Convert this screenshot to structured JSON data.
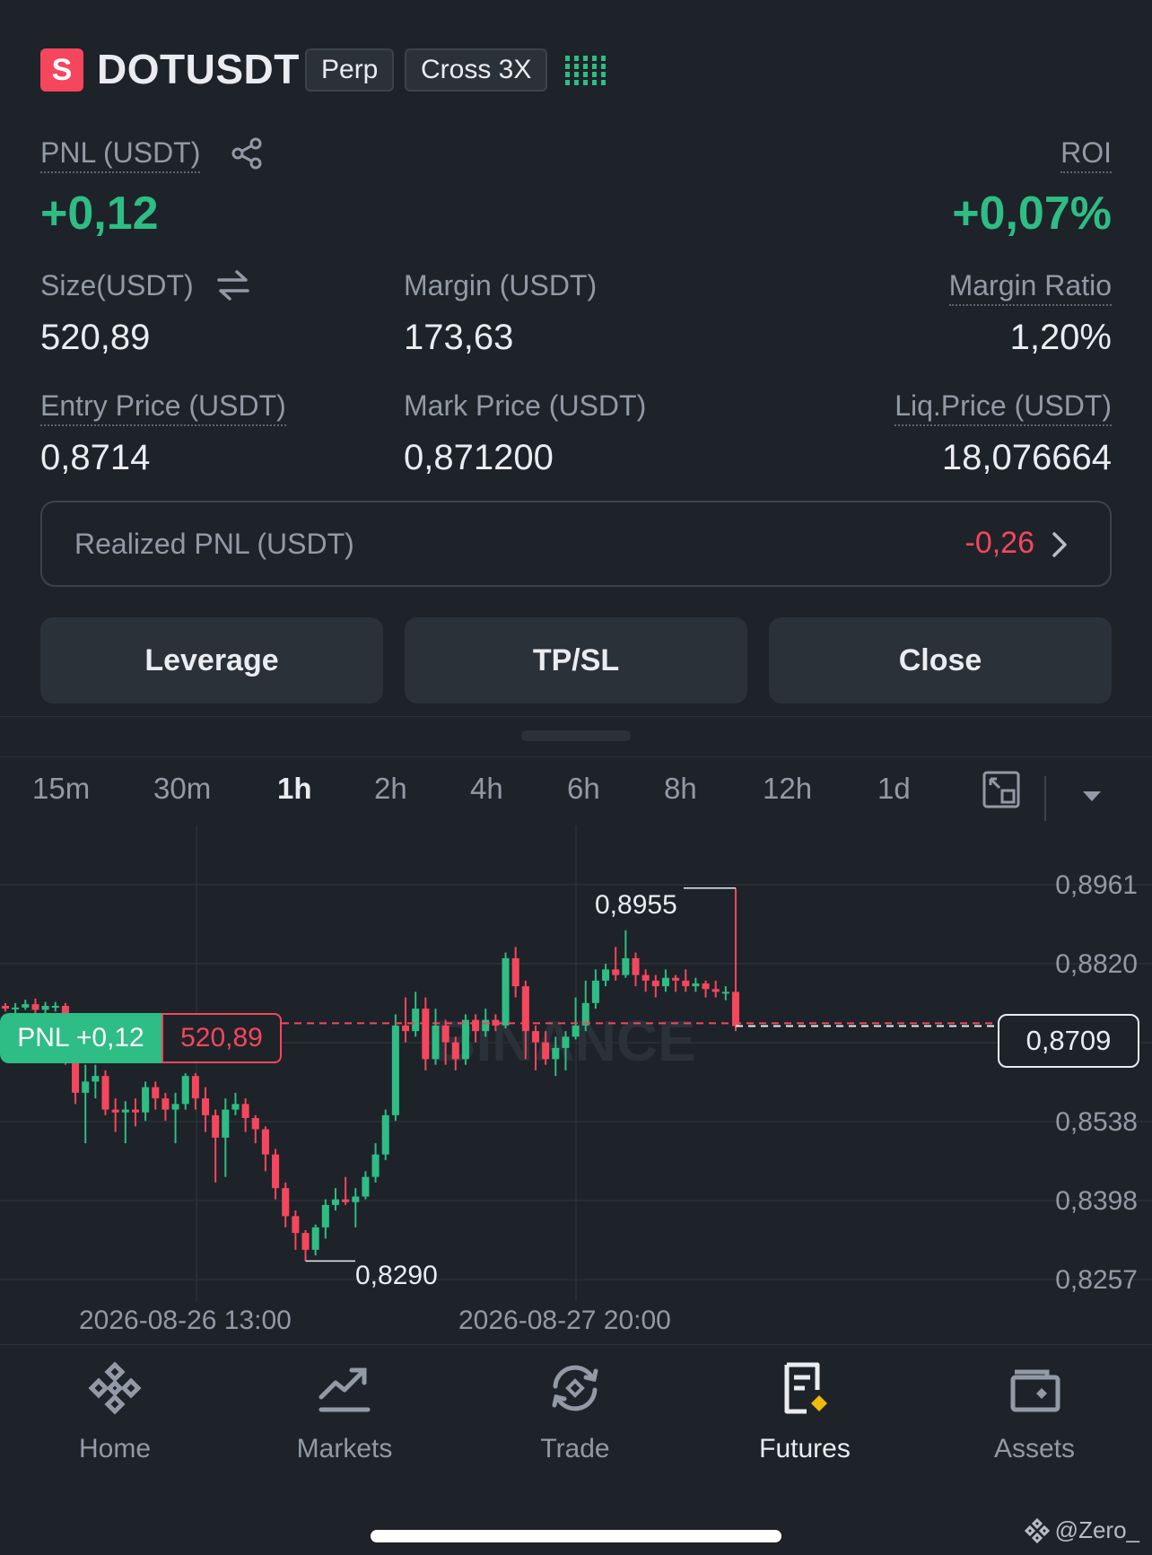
{
  "header": {
    "badge": "S",
    "symbol": "DOTUSDT",
    "tag_type": "Perp",
    "tag_margin": "Cross 3X"
  },
  "position": {
    "pnl_label": "PNL (USDT)",
    "pnl_value": "+0,12",
    "roi_label": "ROI",
    "roi_value": "+0,07%",
    "size_label": "Size(USDT)",
    "size_value": "520,89",
    "margin_label": "Margin (USDT)",
    "margin_value": "173,63",
    "margin_ratio_label": "Margin Ratio",
    "margin_ratio_value": "1,20%",
    "entry_label": "Entry Price (USDT)",
    "entry_value": "0,8714",
    "mark_label": "Mark Price (USDT)",
    "mark_value": "0,871200",
    "liq_label": "Liq.Price (USDT)",
    "liq_value": "18,076664",
    "realized_label": "Realized PNL (USDT)",
    "realized_value": "-0,26"
  },
  "actions": {
    "leverage": "Leverage",
    "tpsl": "TP/SL",
    "close": "Close"
  },
  "timeframes": [
    "15m",
    "30m",
    "1h",
    "2h",
    "4h",
    "6h",
    "8h",
    "12h",
    "1d"
  ],
  "active_timeframe": "1h",
  "chart": {
    "pnl_tag": "PNL +0,12",
    "size_tag": "520,89",
    "high_label": "0,8955",
    "low_label": "0,8290",
    "current_price": "0,8709",
    "watermark": "BINANCE",
    "y_ticks": [
      "0,8961",
      "0,8820",
      "0,8538",
      "0,8398",
      "0,8257"
    ],
    "x_ticks": [
      "2026-08-26 13:00",
      "2026-08-27 20:00"
    ]
  },
  "chart_data": {
    "type": "candlestick",
    "interval": "1h",
    "ylim": [
      0.8257,
      0.8961
    ],
    "y_ticks": [
      0.8961,
      0.882,
      0.8538,
      0.8398,
      0.8257
    ],
    "x_ticks": [
      "2026-08-26 13:00",
      "2026-08-27 20:00"
    ],
    "high": 0.8955,
    "low": 0.829,
    "current": 0.8709,
    "entry": 0.8714,
    "up_color": "#2ebd85",
    "down_color": "#f6465d",
    "candles": [
      [
        0.8745,
        0.874,
        0.875,
        0.8735
      ],
      [
        0.874,
        0.8742,
        0.875,
        0.8732
      ],
      [
        0.8742,
        0.8748,
        0.8756,
        0.8738
      ],
      [
        0.8748,
        0.8738,
        0.8758,
        0.8728
      ],
      [
        0.8738,
        0.8745,
        0.8752,
        0.873
      ],
      [
        0.8745,
        0.8745,
        0.8752,
        0.8735
      ],
      [
        0.8745,
        0.866,
        0.875,
        0.864
      ],
      [
        0.866,
        0.859,
        0.867,
        0.857
      ],
      [
        0.859,
        0.861,
        0.864,
        0.85
      ],
      [
        0.861,
        0.862,
        0.864,
        0.858
      ],
      [
        0.862,
        0.856,
        0.863,
        0.855
      ],
      [
        0.856,
        0.8555,
        0.858,
        0.852
      ],
      [
        0.8555,
        0.856,
        0.8575,
        0.85
      ],
      [
        0.856,
        0.8555,
        0.858,
        0.853
      ],
      [
        0.8555,
        0.86,
        0.861,
        0.854
      ],
      [
        0.86,
        0.858,
        0.861,
        0.856
      ],
      [
        0.858,
        0.856,
        0.859,
        0.854
      ],
      [
        0.856,
        0.857,
        0.859,
        0.85
      ],
      [
        0.857,
        0.862,
        0.8625,
        0.856
      ],
      [
        0.862,
        0.858,
        0.8625,
        0.856
      ],
      [
        0.858,
        0.855,
        0.86,
        0.852
      ],
      [
        0.855,
        0.851,
        0.856,
        0.843
      ],
      [
        0.851,
        0.856,
        0.858,
        0.844
      ],
      [
        0.856,
        0.857,
        0.859,
        0.855
      ],
      [
        0.857,
        0.8545,
        0.858,
        0.852
      ],
      [
        0.8545,
        0.8525,
        0.855,
        0.85
      ],
      [
        0.8525,
        0.848,
        0.853,
        0.845
      ],
      [
        0.848,
        0.842,
        0.849,
        0.84
      ],
      [
        0.842,
        0.837,
        0.843,
        0.835
      ],
      [
        0.837,
        0.834,
        0.838,
        0.831
      ],
      [
        0.834,
        0.831,
        0.8345,
        0.829
      ],
      [
        0.831,
        0.835,
        0.8355,
        0.83
      ],
      [
        0.835,
        0.839,
        0.84,
        0.833
      ],
      [
        0.839,
        0.84,
        0.842,
        0.838
      ],
      [
        0.84,
        0.8395,
        0.844,
        0.839
      ],
      [
        0.8395,
        0.8405,
        0.842,
        0.835
      ],
      [
        0.8405,
        0.844,
        0.845,
        0.84
      ],
      [
        0.844,
        0.848,
        0.85,
        0.843
      ],
      [
        0.848,
        0.855,
        0.856,
        0.847
      ],
      [
        0.855,
        0.871,
        0.873,
        0.854
      ],
      [
        0.871,
        0.87,
        0.876,
        0.868
      ],
      [
        0.87,
        0.874,
        0.877,
        0.869
      ],
      [
        0.874,
        0.865,
        0.876,
        0.863
      ],
      [
        0.865,
        0.871,
        0.874,
        0.864
      ],
      [
        0.871,
        0.868,
        0.872,
        0.864
      ],
      [
        0.868,
        0.865,
        0.869,
        0.863
      ],
      [
        0.865,
        0.872,
        0.873,
        0.864
      ],
      [
        0.872,
        0.87,
        0.873,
        0.868
      ],
      [
        0.87,
        0.872,
        0.874,
        0.869
      ],
      [
        0.872,
        0.871,
        0.873,
        0.87
      ],
      [
        0.871,
        0.883,
        0.884,
        0.8705
      ],
      [
        0.883,
        0.878,
        0.885,
        0.876
      ],
      [
        0.878,
        0.87,
        0.879,
        0.865
      ],
      [
        0.87,
        0.868,
        0.871,
        0.863
      ],
      [
        0.868,
        0.865,
        0.87,
        0.864
      ],
      [
        0.865,
        0.867,
        0.869,
        0.862
      ],
      [
        0.867,
        0.869,
        0.87,
        0.863
      ],
      [
        0.869,
        0.871,
        0.876,
        0.8685
      ],
      [
        0.871,
        0.875,
        0.879,
        0.87
      ],
      [
        0.875,
        0.879,
        0.881,
        0.874
      ],
      [
        0.879,
        0.881,
        0.882,
        0.878
      ],
      [
        0.881,
        0.88,
        0.885,
        0.879
      ],
      [
        0.88,
        0.883,
        0.888,
        0.8795
      ],
      [
        0.883,
        0.88,
        0.884,
        0.878
      ],
      [
        0.88,
        0.879,
        0.881,
        0.877
      ],
      [
        0.879,
        0.878,
        0.88,
        0.876
      ],
      [
        0.878,
        0.8795,
        0.881,
        0.877
      ],
      [
        0.8795,
        0.879,
        0.88,
        0.877
      ],
      [
        0.879,
        0.878,
        0.881,
        0.877
      ],
      [
        0.878,
        0.8785,
        0.8795,
        0.877
      ],
      [
        0.8785,
        0.8775,
        0.879,
        0.876
      ],
      [
        0.8775,
        0.877,
        0.879,
        0.876
      ],
      [
        0.877,
        0.877,
        0.878,
        0.8755
      ],
      [
        0.877,
        0.8709,
        0.8955,
        0.87
      ]
    ]
  },
  "nav": {
    "home": "Home",
    "markets": "Markets",
    "trade": "Trade",
    "futures": "Futures",
    "assets": "Assets"
  },
  "footer": {
    "credit": "@Zero_"
  }
}
